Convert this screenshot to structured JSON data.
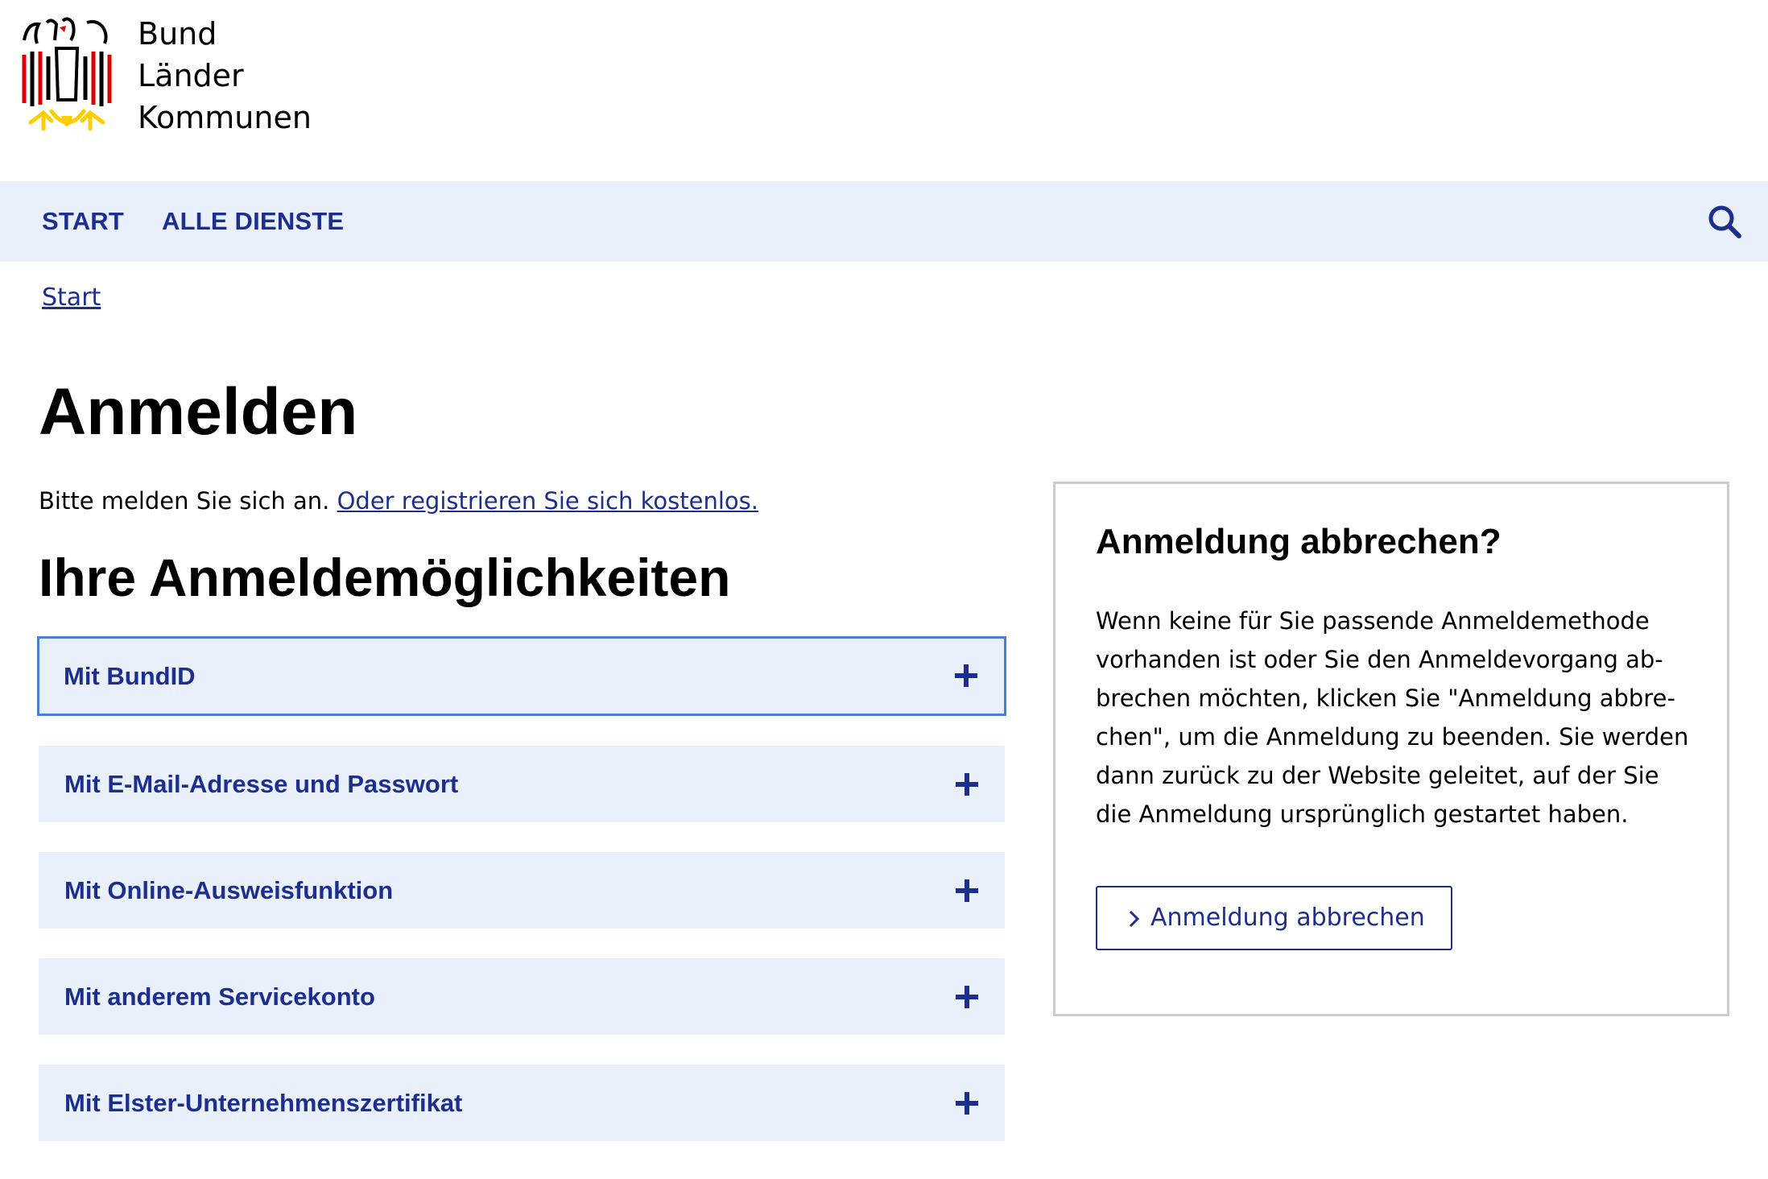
{
  "logo": {
    "lines": [
      "Bund",
      "Länder",
      "Kommunen"
    ],
    "icon": "federal-eagle-icon",
    "colors": {
      "black": "#000000",
      "red": "#dd0000",
      "gold": "#ffce00"
    }
  },
  "nav": {
    "items": [
      {
        "label": "Start"
      },
      {
        "label": "Alle Dienste"
      }
    ],
    "search_icon": "search-icon"
  },
  "breadcrumb": {
    "label": "Start"
  },
  "page": {
    "title": "Anmelden",
    "intro_text": "Bitte melden Sie sich an. ",
    "register_link": "Oder registrieren Sie sich kostenlos.",
    "section_title": "Ihre Anmeldemöglichkeiten"
  },
  "options": [
    {
      "label": "Mit BundID",
      "focused": true
    },
    {
      "label": "Mit E-Mail-Adresse und Passwort"
    },
    {
      "label": "Mit Online-Ausweisfunktion"
    },
    {
      "label": "Mit anderem Servicekonto"
    },
    {
      "label": "Mit Elster-Unternehmenszertifikat"
    }
  ],
  "aside": {
    "title": "Anmeldung abbrechen?",
    "text_lines": [
      "Wenn keine für Sie passende Anmeldemethode",
      "vorhanden ist oder Sie den Anmeldevorgang ab-",
      "brechen möchten, klicken Sie \"Anmeldung abbre-",
      "chen\", um die Anmeldung zu beenden. Sie werden",
      "dann zurück zu der Website geleitet, auf der Sie",
      "die Anmeldung ursprünglich gestartet haben."
    ],
    "button_label": "Anmeldung abbrechen"
  },
  "colors": {
    "primary": "#1c2f8f",
    "nav_bg": "#e9f0fb",
    "focus_border": "#4a7fd1",
    "aside_border": "#cccccc"
  }
}
